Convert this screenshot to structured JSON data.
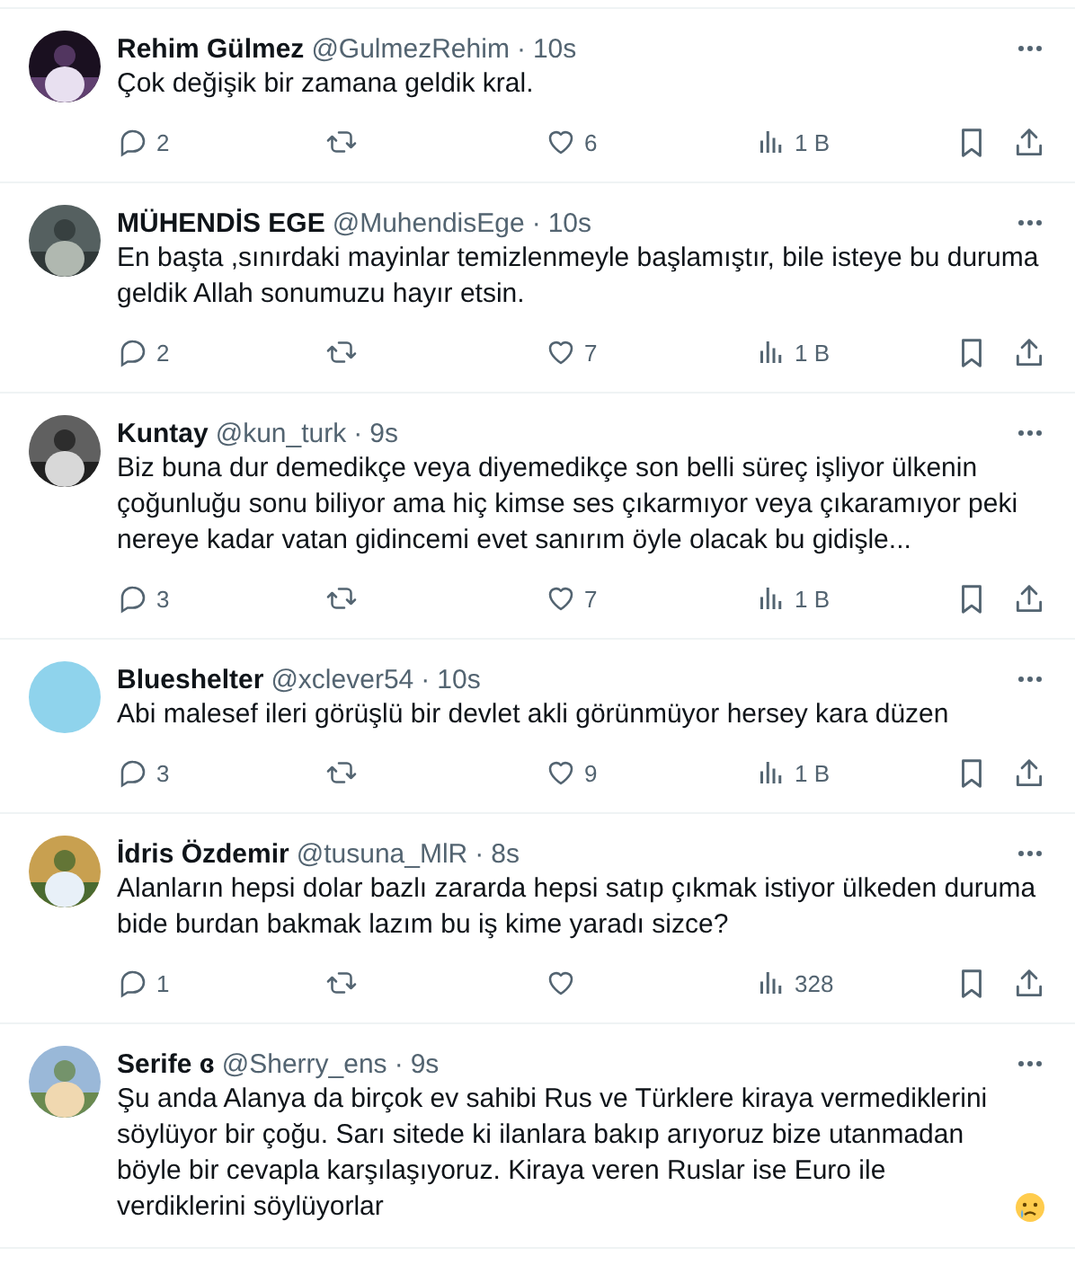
{
  "tweets": [
    {
      "name": "Rehim Gülmez",
      "handle": "@GulmezRehim",
      "separator": "·",
      "time": "10s",
      "text": "Çok değişik bir zamana geldik kral.",
      "replies": "2",
      "likes": "6",
      "views": "1 B"
    },
    {
      "name": "MÜHENDİS EGE",
      "handle": "@MuhendisEge",
      "separator": "·",
      "time": "10s",
      "text": "En başta ,sınırdaki mayinlar temizlenmeyle başlamıştır, bile isteye bu duruma geldik Allah sonumuzu hayır etsin.",
      "replies": "2",
      "likes": "7",
      "views": "1 B"
    },
    {
      "name": "Kuntay",
      "handle": "@kun_turk",
      "separator": "·",
      "time": "9s",
      "text": "Biz buna dur demedikçe veya diyemedikçe son belli süreç işliyor ülkenin çoğunluğu sonu biliyor ama hiç kimse ses çıkarmıyor veya çıkaramıyor peki nereye kadar vatan gidincemi evet sanırım öyle olacak bu gidişle...",
      "replies": "3",
      "likes": "7",
      "views": "1 B"
    },
    {
      "name": "Blueshelter",
      "handle": "@xclever54",
      "separator": "·",
      "time": "10s",
      "avatar": {
        "kind": "plain"
      },
      "text": "Abi malesef ileri görüşlü bir devlet akli görünmüyor hersey kara düzen",
      "replies": "3",
      "likes": "9",
      "views": "1 B"
    },
    {
      "name": "İdris Özdemir",
      "handle": "@tusuna_MlR",
      "separator": "·",
      "time": "8s",
      "text": "Alanların hepsi dolar bazlı zararda hepsi satıp çıkmak istiyor ülkeden duruma bide burdan bakmak lazım bu iş kime yaradı sizce?",
      "replies": "1",
      "views": "328"
    },
    {
      "name": "Serife ɞ",
      "handle": "@Sherry_ens",
      "separator": "·",
      "time": "9s",
      "text": "Şu anda Alanya da birçok ev sahibi Rus ve Türklere kiraya vermediklerini söylüyor bir çoğu. Sarı sitede ki ilanlara bakıp arıyoruz bize utanmadan böyle bir cevapla karşılaşıyoruz. Kiraya veren Ruslar ise Euro ile verdiklerini söylüyorlar",
      "crying_emoji": true
    }
  ]
}
